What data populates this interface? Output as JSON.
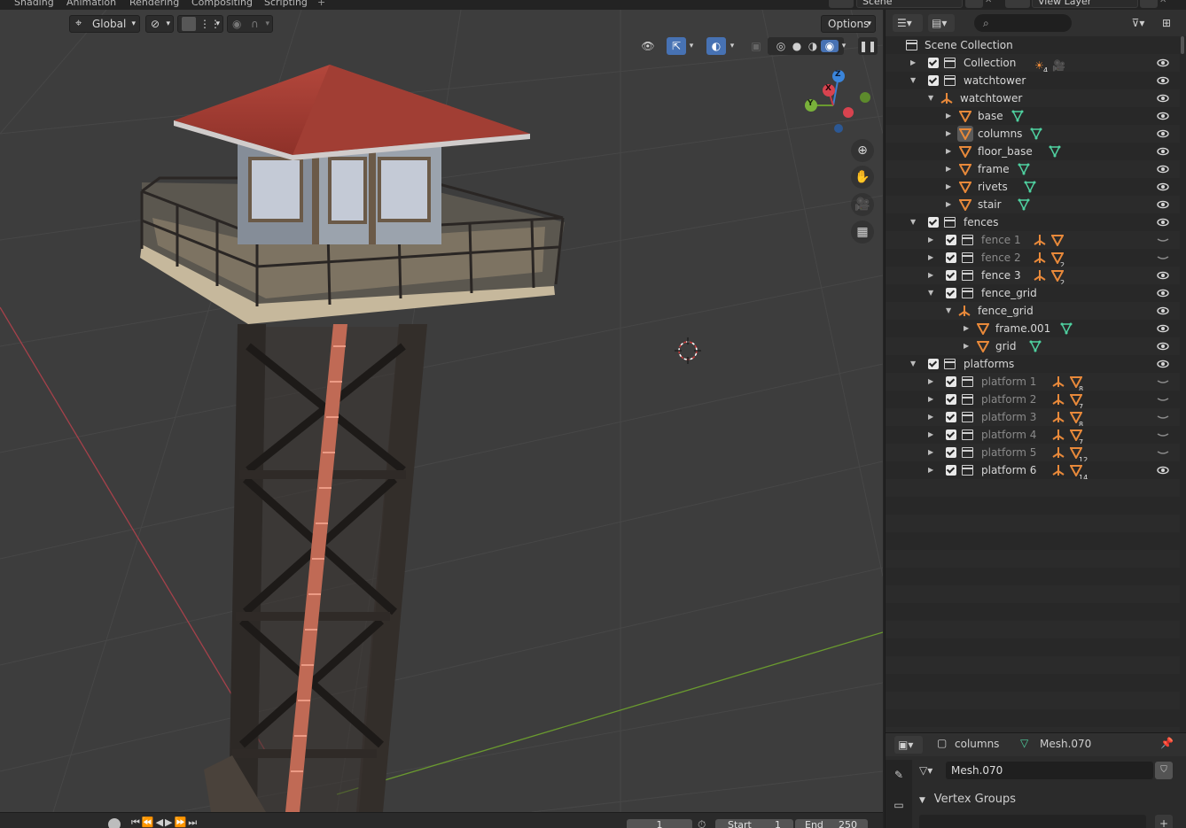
{
  "workspace_tabs": [
    "Shading",
    "Animation",
    "Rendering",
    "Compositing",
    "Scripting",
    "+"
  ],
  "scene": {
    "scene_name": "Scene",
    "view_layer": "View Layer"
  },
  "viewport": {
    "transform_orientation": "Global",
    "options_label": "Options",
    "gizmo_axes": {
      "z": "Z",
      "y": "Y",
      "x": "X"
    },
    "colors": {
      "x_axis": "#c0474f",
      "y_axis": "#7aa13a",
      "bg": "#3d3d3d",
      "grid": "#474747"
    }
  },
  "timeline": {
    "current_frame": "1",
    "start_label": "Start",
    "start_value": "1",
    "end_label": "End",
    "end_value": "250"
  },
  "outliner": {
    "root_label": "Scene Collection",
    "rows": [
      {
        "label": "Collection",
        "indent": 0,
        "kind": "collection",
        "tri": "right",
        "check": true,
        "dim": false,
        "extras": [
          {
            "type": "light",
            "count": "4"
          },
          {
            "type": "camera",
            "count": ""
          }
        ],
        "visible": true
      },
      {
        "label": "watchtower",
        "indent": 0,
        "kind": "collection",
        "tri": "down",
        "check": true,
        "dim": false,
        "extras": [],
        "visible": true
      },
      {
        "label": "watchtower",
        "indent": 1,
        "kind": "empty",
        "tri": "down",
        "check": false,
        "dim": false,
        "extras": [],
        "visible": true
      },
      {
        "label": "base",
        "indent": 2,
        "kind": "mesh",
        "tri": "right",
        "check": false,
        "dim": false,
        "extras": [
          {
            "type": "meshdata",
            "count": ""
          }
        ],
        "visible": true
      },
      {
        "label": "columns",
        "indent": 2,
        "kind": "mesh-selected",
        "tri": "right",
        "check": false,
        "dim": false,
        "extras": [
          {
            "type": "meshdata",
            "count": ""
          }
        ],
        "visible": true
      },
      {
        "label": "floor_base",
        "indent": 2,
        "kind": "mesh",
        "tri": "right",
        "check": false,
        "dim": false,
        "extras": [
          {
            "type": "meshdata",
            "count": ""
          }
        ],
        "visible": true
      },
      {
        "label": "frame",
        "indent": 2,
        "kind": "mesh",
        "tri": "right",
        "check": false,
        "dim": false,
        "extras": [
          {
            "type": "meshdata",
            "count": ""
          }
        ],
        "visible": true
      },
      {
        "label": "rivets",
        "indent": 2,
        "kind": "mesh",
        "tri": "right",
        "check": false,
        "dim": false,
        "extras": [
          {
            "type": "meshdata",
            "count": ""
          }
        ],
        "visible": true
      },
      {
        "label": "stair",
        "indent": 2,
        "kind": "mesh",
        "tri": "right",
        "check": false,
        "dim": false,
        "extras": [
          {
            "type": "meshdata",
            "count": ""
          }
        ],
        "visible": true
      },
      {
        "label": "fences",
        "indent": 0,
        "kind": "collection",
        "tri": "down",
        "check": true,
        "dim": false,
        "extras": [],
        "visible": true
      },
      {
        "label": "fence 1",
        "indent": 1,
        "kind": "collection",
        "tri": "right",
        "check": true,
        "dim": true,
        "extras": [
          {
            "type": "empty",
            "count": ""
          },
          {
            "type": "mesh",
            "count": ""
          }
        ],
        "visible": false
      },
      {
        "label": "fence 2",
        "indent": 1,
        "kind": "collection",
        "tri": "right",
        "check": true,
        "dim": true,
        "extras": [
          {
            "type": "empty",
            "count": ""
          },
          {
            "type": "mesh",
            "count": "2"
          }
        ],
        "visible": false
      },
      {
        "label": "fence 3",
        "indent": 1,
        "kind": "collection",
        "tri": "right",
        "check": true,
        "dim": false,
        "extras": [
          {
            "type": "empty",
            "count": ""
          },
          {
            "type": "mesh",
            "count": "2"
          }
        ],
        "visible": true
      },
      {
        "label": "fence_grid",
        "indent": 1,
        "kind": "collection",
        "tri": "down",
        "check": true,
        "dim": false,
        "extras": [],
        "visible": true
      },
      {
        "label": "fence_grid",
        "indent": 2,
        "kind": "empty",
        "tri": "down",
        "check": false,
        "dim": false,
        "extras": [],
        "visible": true
      },
      {
        "label": "frame.001",
        "indent": 3,
        "kind": "mesh",
        "tri": "right",
        "check": false,
        "dim": false,
        "extras": [
          {
            "type": "meshdata",
            "count": ""
          }
        ],
        "visible": true
      },
      {
        "label": "grid",
        "indent": 3,
        "kind": "mesh",
        "tri": "right",
        "check": false,
        "dim": false,
        "extras": [
          {
            "type": "meshdata",
            "count": ""
          }
        ],
        "visible": true
      },
      {
        "label": "platforms",
        "indent": 0,
        "kind": "collection",
        "tri": "down",
        "check": true,
        "dim": false,
        "extras": [],
        "visible": true
      },
      {
        "label": "platform 1",
        "indent": 1,
        "kind": "collection",
        "tri": "right",
        "check": true,
        "dim": true,
        "extras": [
          {
            "type": "empty",
            "count": ""
          },
          {
            "type": "mesh",
            "count": "8"
          }
        ],
        "visible": false
      },
      {
        "label": "platform 2",
        "indent": 1,
        "kind": "collection",
        "tri": "right",
        "check": true,
        "dim": true,
        "extras": [
          {
            "type": "empty",
            "count": ""
          },
          {
            "type": "mesh",
            "count": "7"
          }
        ],
        "visible": false
      },
      {
        "label": "platform 3",
        "indent": 1,
        "kind": "collection",
        "tri": "right",
        "check": true,
        "dim": true,
        "extras": [
          {
            "type": "empty",
            "count": ""
          },
          {
            "type": "mesh",
            "count": "8"
          }
        ],
        "visible": false
      },
      {
        "label": "platform 4",
        "indent": 1,
        "kind": "collection",
        "tri": "right",
        "check": true,
        "dim": true,
        "extras": [
          {
            "type": "empty",
            "count": ""
          },
          {
            "type": "mesh",
            "count": "7"
          }
        ],
        "visible": false
      },
      {
        "label": "platform 5",
        "indent": 1,
        "kind": "collection",
        "tri": "right",
        "check": true,
        "dim": true,
        "extras": [
          {
            "type": "empty",
            "count": ""
          },
          {
            "type": "mesh",
            "count": "12"
          }
        ],
        "visible": false
      },
      {
        "label": "platform 6",
        "indent": 1,
        "kind": "collection",
        "tri": "right",
        "check": true,
        "dim": false,
        "extras": [
          {
            "type": "empty",
            "count": ""
          },
          {
            "type": "mesh",
            "count": "14"
          }
        ],
        "visible": true
      }
    ],
    "colors": {
      "object": "#e8893a",
      "meshdata": "#4fd1a0"
    }
  },
  "properties": {
    "object_name": "columns",
    "mesh_name": "Mesh.070",
    "data_field": "Mesh.070",
    "panel_title": "Vertex Groups"
  }
}
